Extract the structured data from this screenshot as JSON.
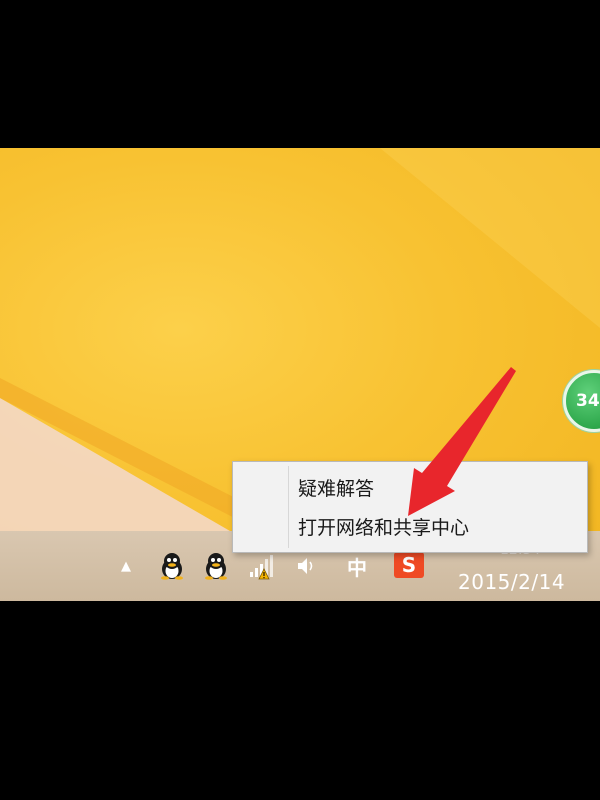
{
  "desktop": {
    "gauge_value": "34"
  },
  "context_menu": {
    "items": [
      {
        "label": "疑难解答"
      },
      {
        "label": "打开网络和共享中心"
      }
    ]
  },
  "taskbar": {
    "show_hidden_icon": "▲",
    "tray_icons": [
      "qq-icon",
      "qq-icon",
      "network-warning-icon",
      "volume-icon"
    ],
    "ime_label": "中",
    "sogou_label": "S",
    "clock_time": "12:34",
    "clock_date": "2015/2/14"
  },
  "colors": {
    "wallpaper": "#f7c02f",
    "arrow": "#e8262c",
    "gauge": "#2ea84c",
    "sogou": "#ef4a24"
  }
}
